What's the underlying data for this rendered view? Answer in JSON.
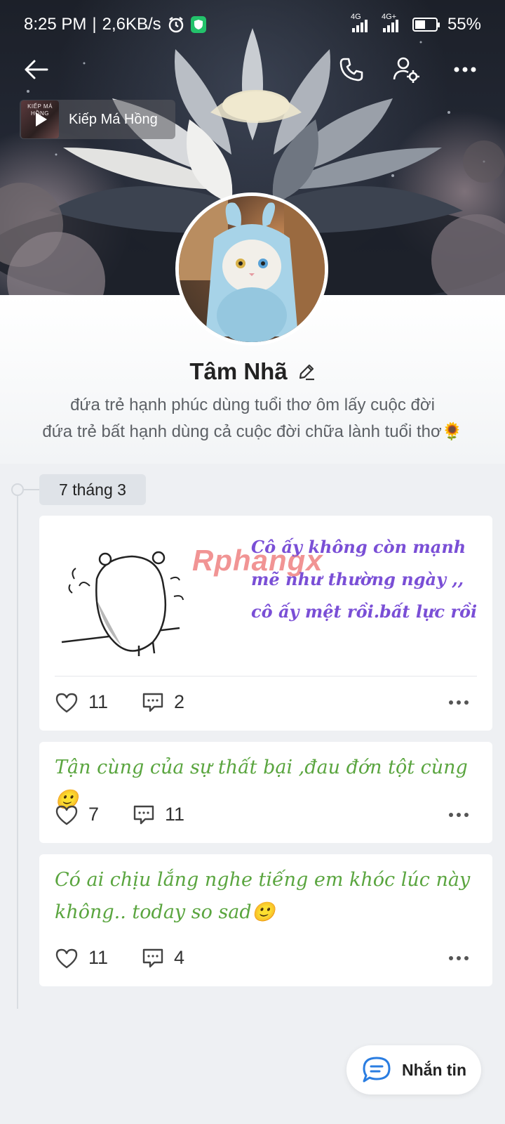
{
  "status_bar": {
    "time": "8:25 PM",
    "net_speed": "2,6KB/s",
    "network_1": "4G",
    "network_2": "4G+",
    "battery": "55%"
  },
  "music": {
    "title": "Kiếp Má Hồng",
    "thumb_text": "KIẾP MÁ HỒNG"
  },
  "profile": {
    "name": "Tâm Nhã",
    "bio_line_1": "đứa trẻ hạnh phúc dùng tuổi thơ ôm lấy cuộc đời",
    "bio_line_2": "đứa trẻ bất hạnh dùng cả cuộc đời chữa lành tuổi thơ🌻"
  },
  "timeline": {
    "date_label": "7 tháng 3"
  },
  "posts": [
    {
      "image_caption": "Cô ấy không còn mạnh mẽ như thường ngày ,, cô ấy mệt rồi.bất lực rồi",
      "watermark": "Rphangx",
      "likes": "11",
      "comments": "2"
    },
    {
      "text": "Tận cùng của sự thất bại ,đau đớn tột cùng 🙂",
      "likes": "7",
      "comments": "11"
    },
    {
      "text": "Có ai chịu lắng nghe tiếng em khóc lúc này không.. today so sad🙂",
      "likes": "11",
      "comments": "4"
    }
  ],
  "message_button": {
    "label": "Nhắn tin"
  },
  "colors": {
    "post_text": "#5aa53f",
    "caption_text": "#7a4fd6",
    "shield": "#23c26b",
    "message_icon": "#2a7de1"
  }
}
